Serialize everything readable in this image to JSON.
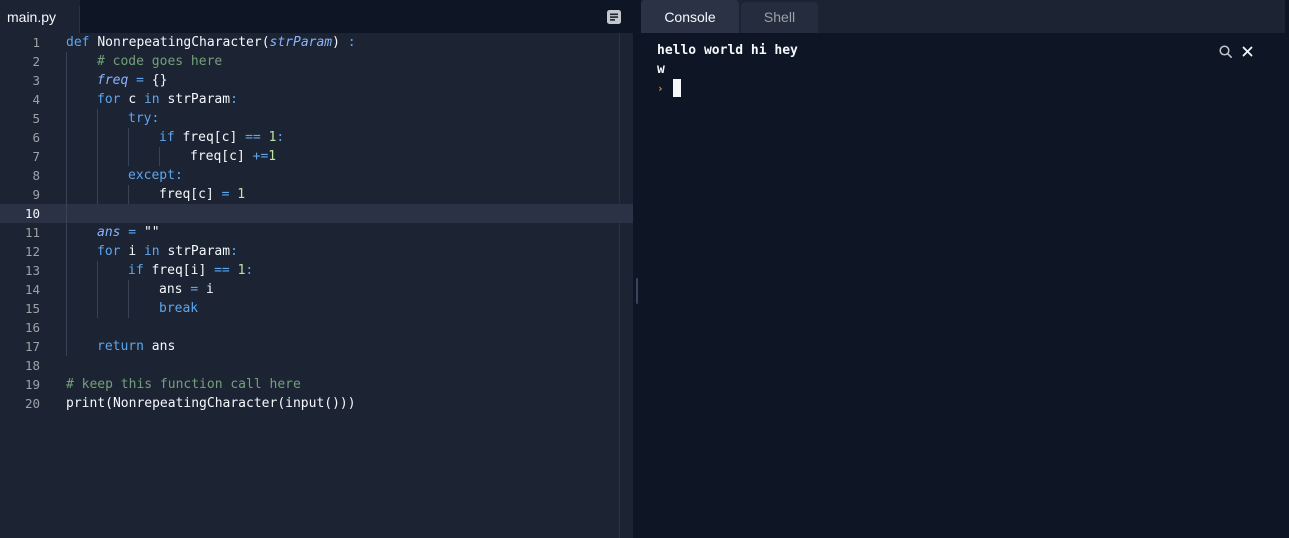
{
  "editor": {
    "file_tab": "main.py",
    "menu_icon": "list-icon",
    "active_line": 10,
    "lines": [
      {
        "num": "1",
        "tokens": [
          [
            "k",
            "def "
          ],
          [
            "fn",
            "NonrepeatingCharacter"
          ],
          [
            "st",
            "("
          ],
          [
            "pr",
            "strParam"
          ],
          [
            "st",
            ") "
          ],
          [
            "op",
            ":"
          ]
        ]
      },
      {
        "num": "2",
        "tokens": [
          [
            "cm",
            "# code goes here"
          ]
        ]
      },
      {
        "num": "3",
        "tokens": [
          [
            "pr",
            "freq"
          ],
          [
            "op",
            " = "
          ],
          [
            "st",
            "{}"
          ]
        ]
      },
      {
        "num": "4",
        "tokens": [
          [
            "k",
            "for "
          ],
          [
            "st",
            "c "
          ],
          [
            "k",
            "in "
          ],
          [
            "st",
            "strParam"
          ],
          [
            "op",
            ":"
          ]
        ]
      },
      {
        "num": "5",
        "tokens": [
          [
            "k",
            "try"
          ],
          [
            "op",
            ":"
          ]
        ]
      },
      {
        "num": "6",
        "tokens": [
          [
            "k",
            "if "
          ],
          [
            "st",
            "freq[c] "
          ],
          [
            "op",
            "== "
          ],
          [
            "nm",
            "1"
          ],
          [
            "op",
            ":"
          ]
        ]
      },
      {
        "num": "7",
        "tokens": [
          [
            "st",
            "freq[c] "
          ],
          [
            "op",
            "+="
          ],
          [
            "nm",
            "1"
          ]
        ]
      },
      {
        "num": "8",
        "tokens": [
          [
            "k",
            "except"
          ],
          [
            "op",
            ":"
          ]
        ]
      },
      {
        "num": "9",
        "tokens": [
          [
            "st",
            "freq[c] "
          ],
          [
            "op",
            "= "
          ],
          [
            "nm",
            "1"
          ]
        ]
      },
      {
        "num": "10",
        "tokens": []
      },
      {
        "num": "11",
        "tokens": [
          [
            "pr",
            "ans"
          ],
          [
            "op",
            " = "
          ],
          [
            "st",
            "\"\""
          ]
        ]
      },
      {
        "num": "12",
        "tokens": [
          [
            "k",
            "for "
          ],
          [
            "st",
            "i "
          ],
          [
            "k",
            "in "
          ],
          [
            "st",
            "strParam"
          ],
          [
            "op",
            ":"
          ]
        ]
      },
      {
        "num": "13",
        "tokens": [
          [
            "k",
            "if "
          ],
          [
            "st",
            "freq[i] "
          ],
          [
            "op",
            "== "
          ],
          [
            "nm",
            "1"
          ],
          [
            "op",
            ":"
          ]
        ]
      },
      {
        "num": "14",
        "tokens": [
          [
            "st",
            "ans "
          ],
          [
            "op",
            "= "
          ],
          [
            "st",
            "i"
          ]
        ]
      },
      {
        "num": "15",
        "tokens": [
          [
            "k",
            "break"
          ]
        ]
      },
      {
        "num": "16",
        "tokens": []
      },
      {
        "num": "17",
        "tokens": [
          [
            "k",
            "return "
          ],
          [
            "st",
            "ans"
          ]
        ]
      },
      {
        "num": "18",
        "tokens": []
      },
      {
        "num": "19",
        "tokens": [
          [
            "cm",
            "# keep this function call here"
          ]
        ]
      },
      {
        "num": "20",
        "tokens": [
          [
            "st",
            "print(NonrepeatingCharacter(input()))"
          ]
        ]
      }
    ]
  },
  "console": {
    "tabs": [
      {
        "label": "Console",
        "active": true
      },
      {
        "label": "Shell",
        "active": false
      }
    ],
    "output": [
      "hello world hi hey",
      "w"
    ],
    "prompt_glyph": "›",
    "search_icon": "search-icon",
    "close_icon": "close-icon"
  },
  "colors": {
    "background": "#0e1525",
    "editor_bg": "#1c2333",
    "active_line": "#2b3245",
    "keyword": "#5ea6ec",
    "comment": "#73a07a",
    "prompt": "#e5843a"
  }
}
